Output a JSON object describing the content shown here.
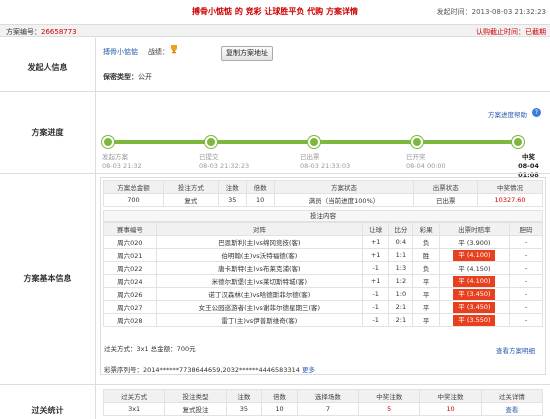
{
  "header": {
    "title": "搏骨小惦惦 的 竞彩 让球胜平负 代购 方案详情",
    "launch_time_label": "发起时间：",
    "launch_time": "2013-08-03 21:32:23"
  },
  "subheader": {
    "scheme_no_label": "方案编号：",
    "scheme_no": "26658773",
    "deadline_label": "认购截止时间：",
    "deadline": "已截期"
  },
  "initiator": {
    "section_label": "发起人信息",
    "username": "搏骨小惦惦",
    "record_label": "战绩：",
    "copy_button": "复制方案地址",
    "promo_label": "保密类型：",
    "promo_value": "公开"
  },
  "progress": {
    "section_label": "方案进度",
    "help_link": "方案进度帮助",
    "steps": [
      {
        "label": "发起方案",
        "time": "08-03 21:32"
      },
      {
        "label": "已提交",
        "time": "08-03 21:32:23"
      },
      {
        "label": "已出票",
        "time": "08-03 21:33:03"
      },
      {
        "label": "已开奖",
        "time": "08-04 00:00"
      },
      {
        "label": "中奖",
        "time": "08-04 01:08"
      }
    ]
  },
  "basic": {
    "section_label": "方案基本信息",
    "summary_headers": [
      "方案总金额",
      "投注方式",
      "注数",
      "倍数",
      "方案状态",
      "出票状态",
      "中奖情况"
    ],
    "summary_row": [
      "700",
      "复式",
      "35",
      "10",
      "满员（当前进度100%）",
      "已出票",
      "10327.60"
    ],
    "bet_content_label": "投注内容",
    "match_headers": [
      "赛事编号",
      "对阵",
      "让球",
      "比分",
      "彩果",
      "出票时赔率",
      "胆码"
    ],
    "matches": [
      {
        "id": "周六020",
        "vs": "巴恩斯利(主)vs绵冈竞技(客)",
        "handicap": "+1",
        "score": "0:4",
        "result": "负",
        "odds": "平 (3.900)",
        "hl": false,
        "banker": "-"
      },
      {
        "id": "周六021",
        "vs": "伯明翰(主)vs沃特福德(客)",
        "handicap": "+1",
        "score": "1:1",
        "result": "胜",
        "odds": "平 (4.100)",
        "hl": true,
        "banker": "-"
      },
      {
        "id": "周六022",
        "vs": "唐卡斯特(主)vs布莱克浦(客)",
        "handicap": "-1",
        "score": "1:3",
        "result": "负",
        "odds": "平 (4.150)",
        "hl": false,
        "banker": "-"
      },
      {
        "id": "周六024",
        "vs": "米德尔斯堡(主)vs莱切斯特城(客)",
        "handicap": "+1",
        "score": "1:2",
        "result": "平",
        "odds": "平 (4.100)",
        "hl": true,
        "banker": "-"
      },
      {
        "id": "周六026",
        "vs": "诺丁汉森林(主)vs哈德斯菲尔德(客)",
        "handicap": "-1",
        "score": "1:0",
        "result": "平",
        "odds": "平 (3.450)",
        "hl": true,
        "banker": "-"
      },
      {
        "id": "周六027",
        "vs": "女王公园巡游者(主)vs谢菲尔德星期三(客)",
        "handicap": "-1",
        "score": "2:1",
        "result": "平",
        "odds": "平 (3.450)",
        "hl": true,
        "banker": "-"
      },
      {
        "id": "周六028",
        "vs": "雷丁(主)vs伊普斯维奇(客)",
        "handicap": "-1",
        "score": "2:1",
        "result": "平",
        "odds": "平 (3.550)",
        "hl": true,
        "banker": "-"
      }
    ],
    "pass_line": "过关方式：3x1 总金额：700元",
    "detail_link": "查看方案明细",
    "serial_label": "彩票序列号：",
    "serial_value": "2014******7738644659,2032******4446583314",
    "more_link": "更多"
  },
  "stats": {
    "section_label": "过关统计",
    "headers": [
      "过关方式",
      "投注类型",
      "注数",
      "倍数",
      "选择场数",
      "中奖注数",
      "中奖注数",
      "过关详情"
    ],
    "row": [
      "3x1",
      "复式投注",
      "35",
      "10",
      "7",
      "5",
      "10",
      "查看"
    ]
  },
  "colors": {
    "accent_red": "#cc0000",
    "progress_green": "#7cb83e",
    "win_odds": "#e8401f",
    "link_blue": "#2a5db0"
  }
}
